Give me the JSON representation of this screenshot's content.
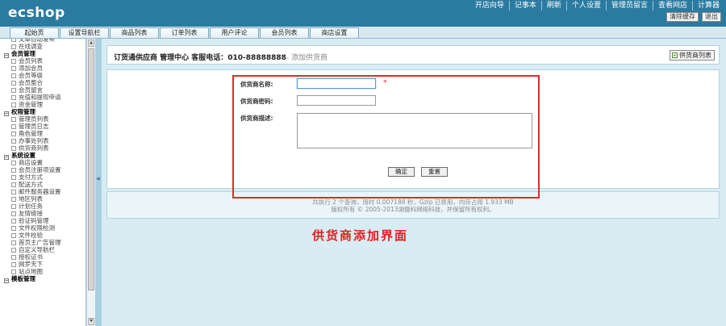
{
  "header": {
    "logo_text": "ecshop",
    "top_links": [
      "开店向导",
      "记事本",
      "刷新",
      "个人设置",
      "管理员留言",
      "查看网店",
      "计算器"
    ],
    "buttons": [
      "清除缓存",
      "退出"
    ]
  },
  "nav": {
    "tabs": [
      "起始页",
      "设置导航栏",
      "商品列表",
      "订单列表",
      "用户评论",
      "会员列表",
      "商店设置"
    ]
  },
  "sidebar": {
    "rows": [
      {
        "type": "item",
        "label": "文章自动发布",
        "cls": "first"
      },
      {
        "type": "item",
        "label": "在线调查"
      },
      {
        "type": "cat",
        "label": "会员管理"
      },
      {
        "type": "item",
        "label": "会员列表"
      },
      {
        "type": "item",
        "label": "添加会员"
      },
      {
        "type": "item",
        "label": "会员等级"
      },
      {
        "type": "item",
        "label": "会员整合"
      },
      {
        "type": "item",
        "label": "会员留言"
      },
      {
        "type": "item",
        "label": "充值和提现申请"
      },
      {
        "type": "item",
        "label": "资金管理"
      },
      {
        "type": "cat",
        "label": "权限管理"
      },
      {
        "type": "item",
        "label": "管理员列表"
      },
      {
        "type": "item",
        "label": "管理员日志"
      },
      {
        "type": "item",
        "label": "角色管理"
      },
      {
        "type": "item",
        "label": "办事处列表"
      },
      {
        "type": "item",
        "label": "供货商列表"
      },
      {
        "type": "cat",
        "label": "系统设置"
      },
      {
        "type": "item",
        "label": "商店设置"
      },
      {
        "type": "item",
        "label": "会员注册项设置"
      },
      {
        "type": "item",
        "label": "支付方式"
      },
      {
        "type": "item",
        "label": "配送方式"
      },
      {
        "type": "item",
        "label": "邮件服务器设置"
      },
      {
        "type": "item",
        "label": "地区列表"
      },
      {
        "type": "item",
        "label": "计划任务"
      },
      {
        "type": "item",
        "label": "友情链接"
      },
      {
        "type": "item",
        "label": "验证码管理"
      },
      {
        "type": "item",
        "label": "文件权限检测"
      },
      {
        "type": "item",
        "label": "文件校验"
      },
      {
        "type": "item",
        "label": "首页主广告管理"
      },
      {
        "type": "item",
        "label": "自定义导航栏"
      },
      {
        "type": "item",
        "label": "授权证书"
      },
      {
        "type": "item",
        "label": "网罗天下"
      },
      {
        "type": "item",
        "label": "站点地图"
      },
      {
        "type": "cat",
        "label": "模板管理"
      }
    ]
  },
  "main": {
    "title": "订货通供应商 管理中心 客服电话：010-88888888",
    "subtitle": "- 添加供货商",
    "list_button": "供货商列表",
    "form": {
      "name_label": "供货商名称:",
      "name_value": "",
      "required_mark": "*",
      "password_label": "供货商密码:",
      "password_value": "",
      "desc_label": "供货商描述:",
      "desc_value": "",
      "submit_label": "确定",
      "reset_label": "重置"
    },
    "footer_line1": "共执行 2 个查询，用时 0.007188 秒，Gzip 已禁用，内存占用 1.933 MB",
    "footer_line2": "版权所有 © 2005-2013湖傲科网络科技，并保留所有权利。"
  },
  "annotation": {
    "caption": "供货商添加界面",
    "color": "#e0201e"
  }
}
